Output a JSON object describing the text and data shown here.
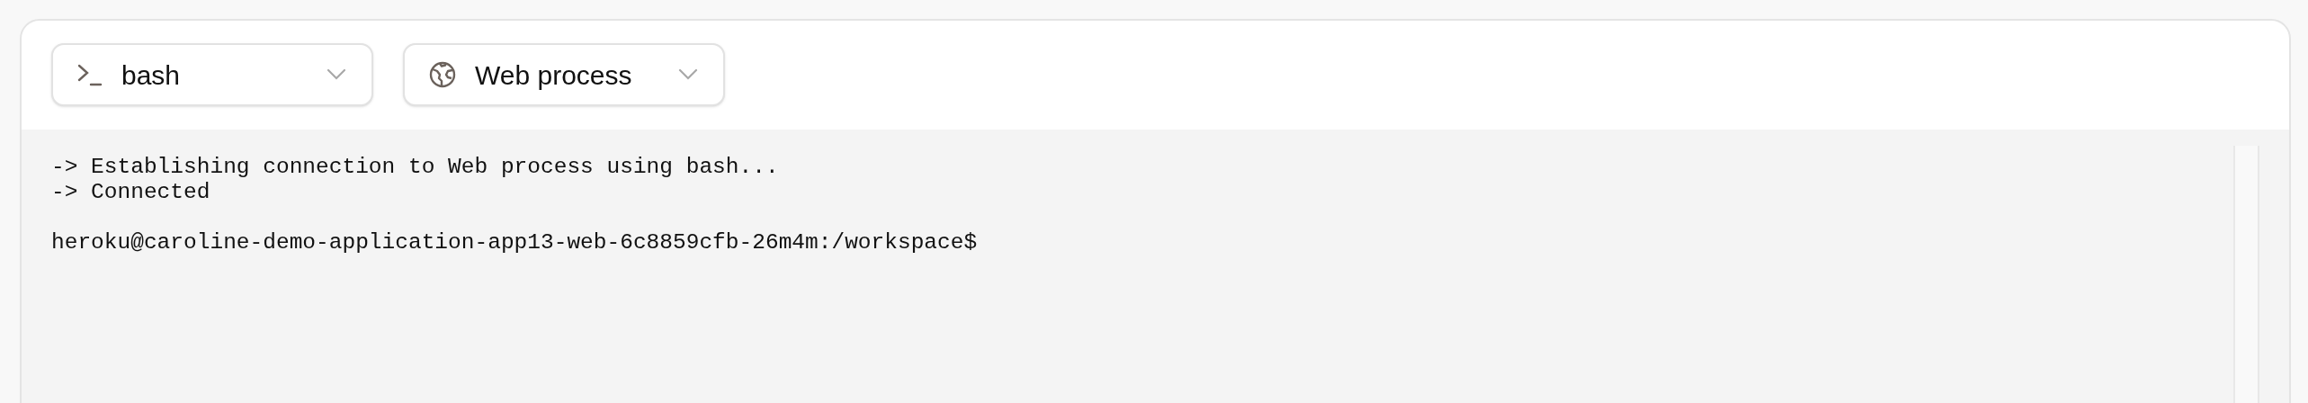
{
  "selectors": [
    {
      "kind": "terminal",
      "label": "bash"
    },
    {
      "kind": "globe",
      "label": "Web process"
    }
  ],
  "terminal": {
    "lines": [
      {
        "kind": "output",
        "text": "-> Establishing connection to Web process using bash..."
      },
      {
        "kind": "output",
        "text": "-> Connected"
      },
      {
        "kind": "prompt",
        "text": "heroku@caroline-demo-application-app13-web-6c8859cfb-26m4m:/workspace$"
      }
    ]
  }
}
